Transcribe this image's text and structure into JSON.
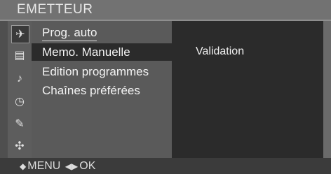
{
  "header": {
    "title": "EMETTEUR"
  },
  "sidebar": {
    "icons": [
      {
        "name": "satellite-dish-icon",
        "glyph": "✈",
        "selected": true
      },
      {
        "name": "picture-icon",
        "glyph": "▤",
        "selected": false
      },
      {
        "name": "audio-icon",
        "glyph": "♪",
        "selected": false
      },
      {
        "name": "clock-icon",
        "glyph": "◷",
        "selected": false
      },
      {
        "name": "special-icon",
        "glyph": "✎",
        "selected": false
      },
      {
        "name": "setup-icon",
        "glyph": "✣",
        "selected": false
      }
    ]
  },
  "menu": {
    "items": [
      {
        "label": "Prog. auto"
      },
      {
        "label": "Memo. Manuelle",
        "selected": true
      },
      {
        "label": "Edition  programmes"
      },
      {
        "label": "Chaînes préférées"
      }
    ]
  },
  "detail": {
    "label": "Validation"
  },
  "footer": {
    "updown_glyph": "◆",
    "menu_label": "MENU",
    "leftright_glyph": "◀▶",
    "ok_label": "OK"
  }
}
